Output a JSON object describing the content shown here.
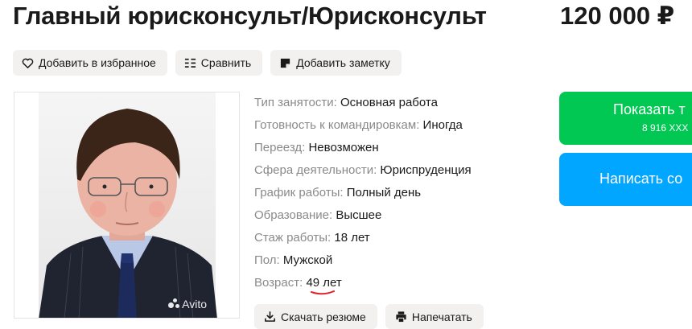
{
  "header": {
    "title": "Главный юрисконсульт/Юрисконсульт",
    "price": "120 000 ₽"
  },
  "actions": {
    "favorite_label": "Добавить в избранное",
    "compare_label": "Сравнить",
    "note_label": "Добавить заметку"
  },
  "photo": {
    "watermark": "Avito"
  },
  "params": [
    {
      "key": "Тип занятости:",
      "value": "Основная работа"
    },
    {
      "key": "Готовность к командировкам:",
      "value": "Иногда"
    },
    {
      "key": "Переезд:",
      "value": "Невозможен"
    },
    {
      "key": "Сфера деятельности:",
      "value": "Юриспруденция"
    },
    {
      "key": "График работы:",
      "value": "Полный день"
    },
    {
      "key": "Образование:",
      "value": "Высшее"
    },
    {
      "key": "Стаж работы:",
      "value": "18 лет"
    },
    {
      "key": "Пол:",
      "value": "Мужской"
    },
    {
      "key": "Возраст:",
      "value": "49 лет"
    }
  ],
  "bottom_actions": {
    "download_label": "Скачать резюме",
    "print_label": "Напечатать"
  },
  "contact": {
    "show_phone_label": "Показать т",
    "phone_partial": "8 916 XXX",
    "write_label": "Написать со"
  },
  "colors": {
    "green": "#00c853",
    "blue": "#00a6ff",
    "chip_bg": "#f2f1f0",
    "underline": "#e0202a"
  }
}
